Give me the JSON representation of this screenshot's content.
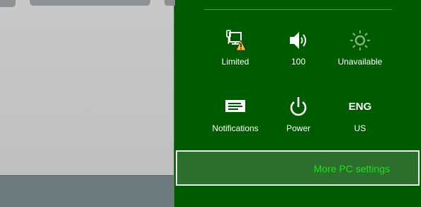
{
  "charm": {
    "tiles": [
      {
        "id": "network",
        "label": "Limited",
        "icon": "network-limited-icon"
      },
      {
        "id": "volume",
        "label": "100",
        "icon": "speaker-icon"
      },
      {
        "id": "brightness",
        "label": "Unavailable",
        "icon": "brightness-icon"
      },
      {
        "id": "notifications",
        "label": "Notifications",
        "icon": "notifications-icon"
      },
      {
        "id": "power",
        "label": "Power",
        "icon": "power-icon"
      },
      {
        "id": "language",
        "label": "US",
        "icon_text": "ENG"
      }
    ],
    "more_settings": "More PC settings"
  },
  "colors": {
    "charm_background": "#005a00",
    "accent_text": "#22dd22",
    "warning": "#f5c518",
    "desktop": "#c4c4c4",
    "taskbar": "#6c7a7c"
  }
}
